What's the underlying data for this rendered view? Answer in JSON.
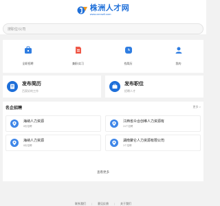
{
  "header": {
    "logo_name": "株洲人才网",
    "logo_url": "www.zzrcw8.com"
  },
  "search": {
    "placeholder": "搜职位/公司"
  },
  "quick": [
    {
      "label": "全职招聘",
      "icon": "briefcase-icon"
    },
    {
      "label": "兼职/实习",
      "icon": "document-icon"
    },
    {
      "label": "找简历",
      "icon": "clock-icon"
    },
    {
      "label": "我的",
      "icon": "person-icon"
    }
  ],
  "cards": [
    {
      "title": "发布简历",
      "sub": "百家好的工作"
    },
    {
      "title": "发布职位",
      "sub": "招聘人才"
    }
  ],
  "companies": {
    "title": "名企招聘",
    "more": "更多 >",
    "items": [
      {
        "name": "海纳人力资源",
        "jobs": "8份招聘"
      },
      {
        "name": "江西省众合创维人力资源有",
        "jobs": "24个招聘"
      },
      {
        "name": "海纳人力资源",
        "jobs": "8份招聘"
      },
      {
        "name": "湖南聚仑人力资源有限公司",
        "jobs": "3个招聘"
      }
    ],
    "view_more": "查看更多"
  },
  "footer": {
    "links": [
      "联系我们",
      "意见反馈",
      "关于我们"
    ]
  },
  "colors": {
    "brand": "#1e6fd9"
  }
}
